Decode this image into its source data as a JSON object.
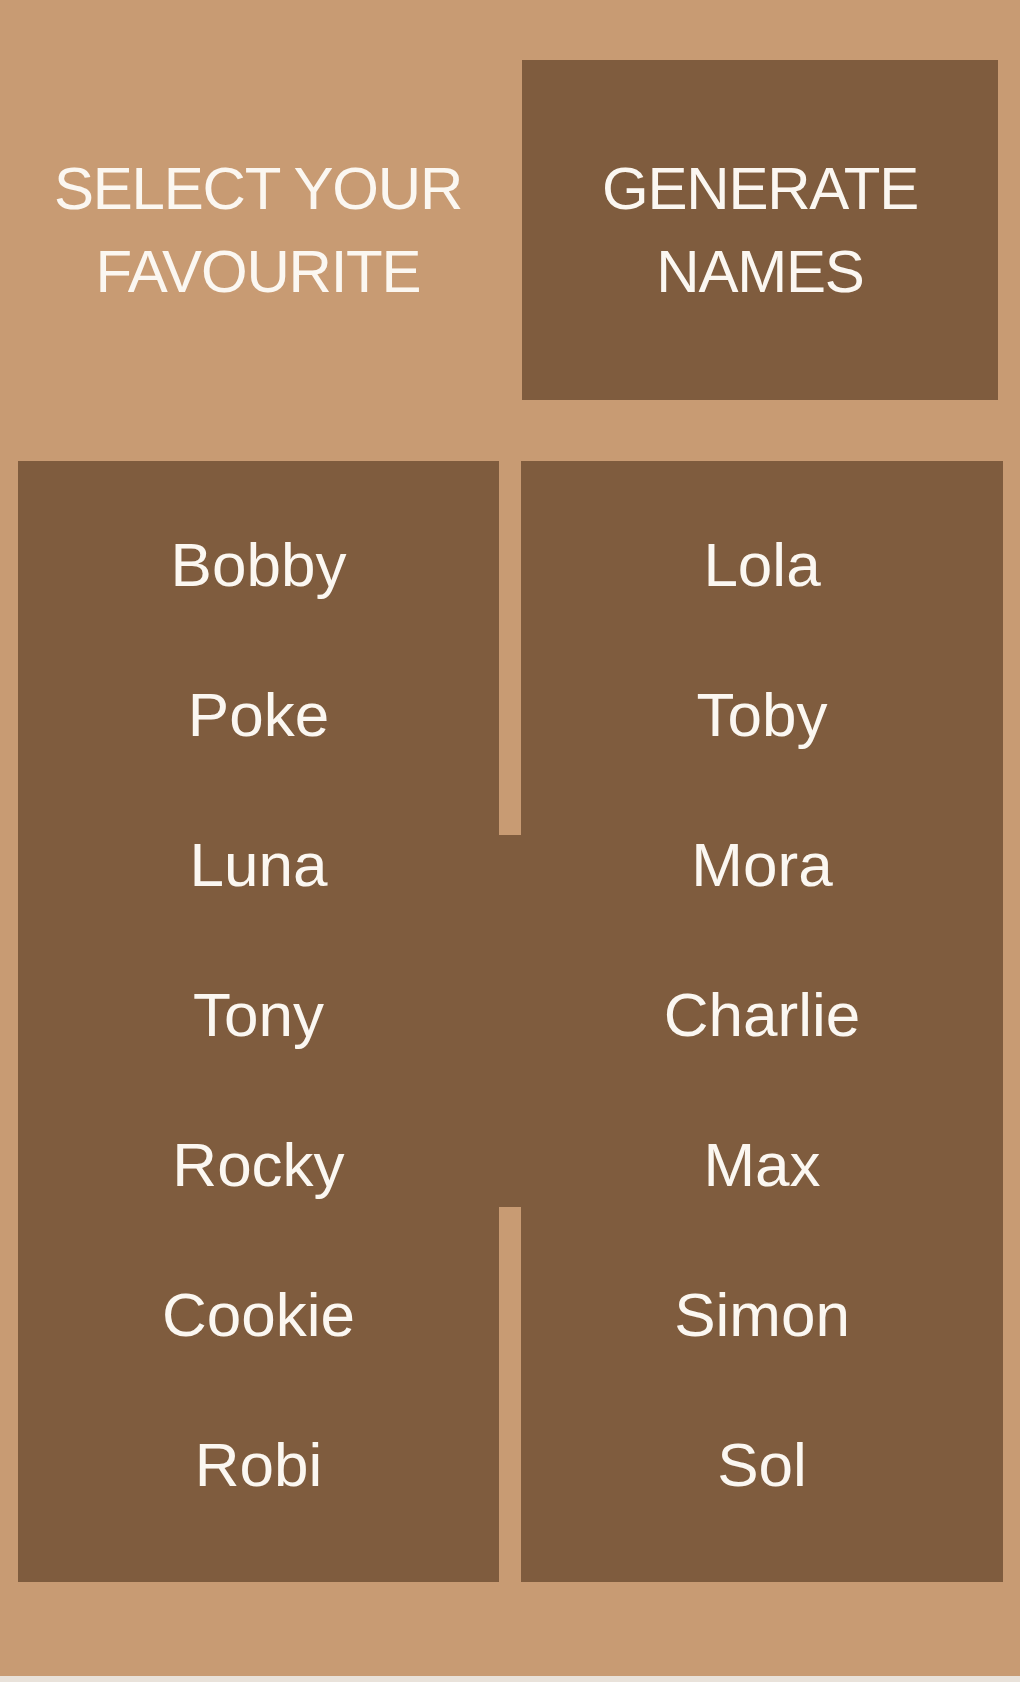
{
  "header": {
    "title": "SELECT YOUR FAVOURITE"
  },
  "generate_button": {
    "label": "GENERATE NAMES"
  },
  "name_columns": [
    {
      "names": [
        {
          "label": "Bobby",
          "selected": false
        },
        {
          "label": "Poke",
          "selected": false
        },
        {
          "label": "Luna",
          "selected": false
        },
        {
          "label": "Tony",
          "selected": false
        },
        {
          "label": "Rocky",
          "selected": false
        },
        {
          "label": "Cookie",
          "selected": false
        },
        {
          "label": "Robi",
          "selected": false
        }
      ]
    },
    {
      "names": [
        {
          "label": "Lola",
          "selected": false
        },
        {
          "label": "Toby",
          "selected": false
        },
        {
          "label": "Mora",
          "selected": false
        },
        {
          "label": "Charlie",
          "selected": false
        },
        {
          "label": "Max",
          "selected": false
        },
        {
          "label": "Simon",
          "selected": false
        },
        {
          "label": "Sol",
          "selected": false
        }
      ]
    }
  ]
}
